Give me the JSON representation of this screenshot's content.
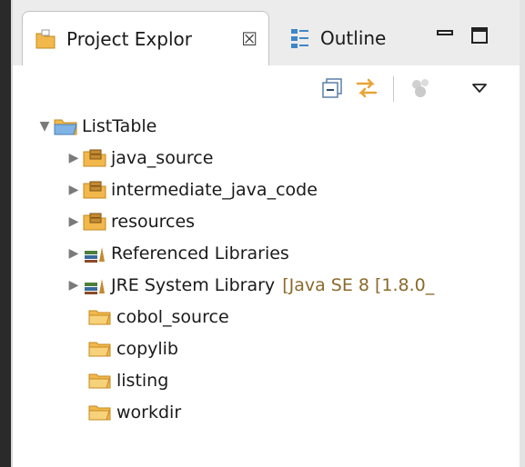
{
  "tabs": {
    "project_explorer": {
      "label": "Project Explor",
      "close_glyph": "☒"
    },
    "outline": {
      "label": "Outline"
    }
  },
  "window_controls": {
    "minimize_glyph": "—",
    "maximize_glyph": "□"
  },
  "tree": {
    "root": {
      "label": "ListTable"
    },
    "items": [
      {
        "label": "java_source",
        "type": "package-folder",
        "expandable": true
      },
      {
        "label": "intermediate_java_code",
        "type": "package-folder",
        "expandable": true
      },
      {
        "label": "resources",
        "type": "package-folder",
        "expandable": true
      },
      {
        "label": "Referenced Libraries",
        "type": "library",
        "expandable": true
      },
      {
        "label": "JRE System Library",
        "decoration": "[Java SE 8 [1.8.0_",
        "type": "library",
        "expandable": true
      },
      {
        "label": "cobol_source",
        "type": "folder",
        "expandable": false
      },
      {
        "label": "copylib",
        "type": "folder",
        "expandable": false
      },
      {
        "label": "listing",
        "type": "folder",
        "expandable": false
      },
      {
        "label": "workdir",
        "type": "folder",
        "expandable": false
      }
    ]
  },
  "colors": {
    "accent": "#e8a437",
    "folder": "#f2b84b",
    "library": "#4d7f3a"
  }
}
